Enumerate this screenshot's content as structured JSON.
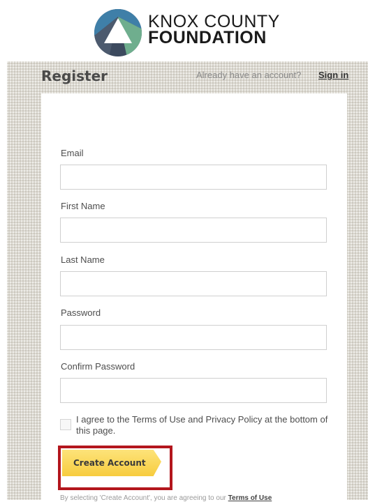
{
  "logo": {
    "line1": "KNOX COUNTY",
    "line2": "FOUNDATION",
    "colors": {
      "blue": "#3f7fa8",
      "green": "#6fae8e",
      "slate": "#3c4a5e",
      "white": "#ffffff"
    }
  },
  "header": {
    "title": "Register",
    "already_text": "Already have an account?",
    "signin_label": "Sign in"
  },
  "form": {
    "fields": [
      {
        "label": "Email",
        "value": ""
      },
      {
        "label": "First Name",
        "value": ""
      },
      {
        "label": "Last Name",
        "value": ""
      },
      {
        "label": "Password",
        "value": ""
      },
      {
        "label": "Confirm Password",
        "value": ""
      }
    ],
    "agree_text": "I agree to the Terms of Use and Privacy Policy at the bottom of this page.",
    "agree_checked": false,
    "create_label": "Create Account",
    "terms_prefix": "By selecting 'Create Account', you are agreeing to our",
    "terms_link": "Terms of Use"
  },
  "colors": {
    "highlight_border": "#b3161d",
    "button_yellow": "#f9d65a"
  }
}
